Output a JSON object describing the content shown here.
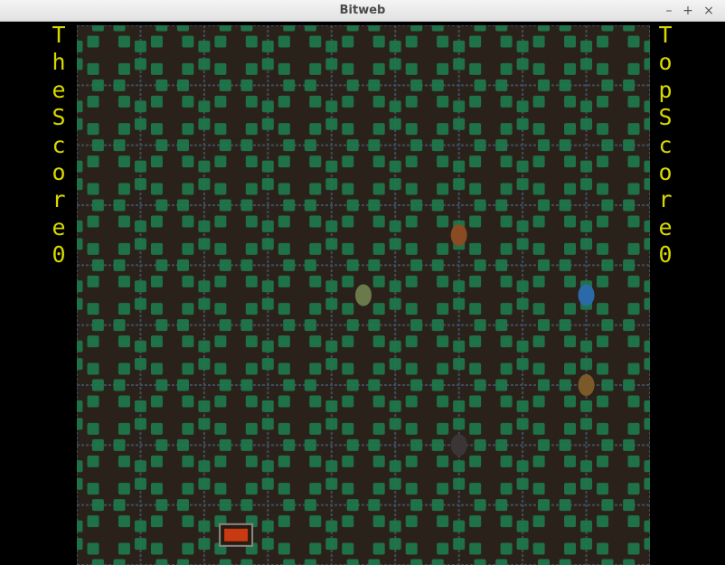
{
  "window": {
    "title": "Bitweb",
    "minimize_label": "–",
    "maximize_label": "+",
    "close_label": "×"
  },
  "hud": {
    "the_score_text": "TheScore0",
    "top_score_text": "TopScore0",
    "text_color": "#d8d800"
  },
  "board": {
    "grid_size": 9,
    "floor_color": "#2a221a",
    "node_color": "#1e7a4c",
    "wire_color": "#3e4d5e",
    "player": {
      "name": "player-creature",
      "row": 4,
      "col": 4,
      "color": "#6a7a4a"
    },
    "enemies": [
      {
        "name": "enemy-bug-orange",
        "row": 3,
        "col": 5.5,
        "color": "#8a4a22"
      },
      {
        "name": "enemy-bug-blue",
        "row": 4,
        "col": 7.5,
        "color": "#2a6aa8"
      },
      {
        "name": "enemy-bug-amber",
        "row": 5.5,
        "col": 7.5,
        "color": "#7a5a28"
      },
      {
        "name": "enemy-bug-dark",
        "row": 6.5,
        "col": 5.5,
        "color": "#3a3636"
      }
    ],
    "home_base": {
      "row": 8,
      "col": 2,
      "color": "#c83a12"
    }
  }
}
